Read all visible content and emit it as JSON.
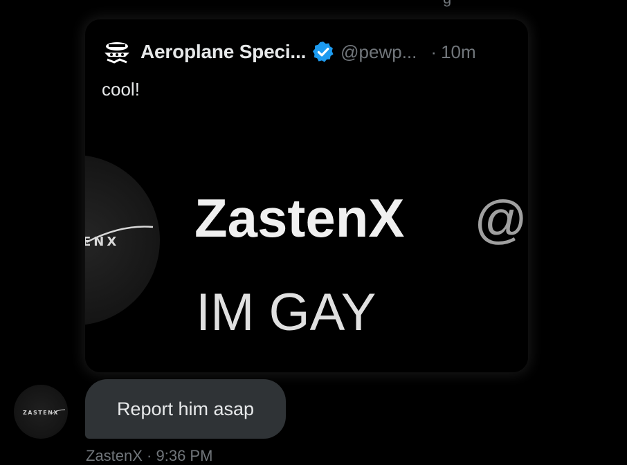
{
  "top_cut_text": "g",
  "quote": {
    "author_name": "Aeroplane Speci...",
    "author_handle": "@pewp...",
    "separator": "·",
    "timestamp": "10m",
    "text": "cool!",
    "verified_color": "#1d9bf0",
    "media": {
      "avatar_logo_text": "ENX",
      "display_name": "ZastenX",
      "handle_fragment": "@",
      "message": "IM GAY"
    }
  },
  "message": {
    "sender_avatar_text": "ZASTENX",
    "text": "Report him asap",
    "bubble_color": "#2f3336",
    "meta_partial": "ZastenX · 9:36 PM"
  }
}
